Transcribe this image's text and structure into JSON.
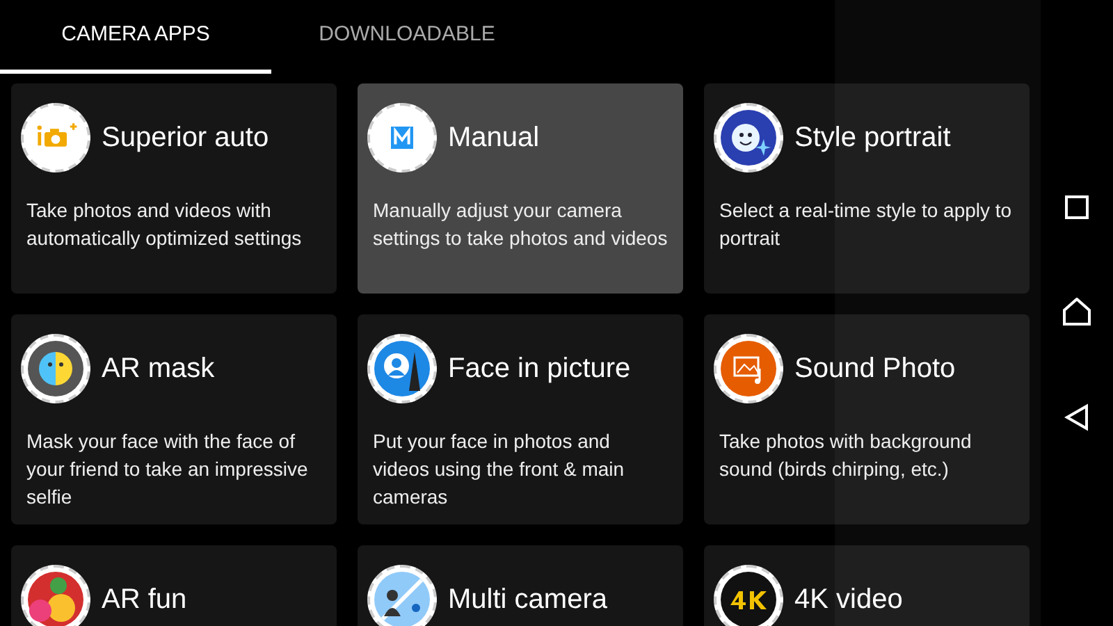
{
  "tabs": [
    {
      "label": "CAMERA APPS",
      "selected": true
    },
    {
      "label": "DOWNLOADABLE",
      "selected": false
    }
  ],
  "apps": [
    {
      "title": "Superior auto",
      "description": "Take photos and videos with automatically optimized settings",
      "selected": false
    },
    {
      "title": "Manual",
      "description": "Manually adjust your camera settings to take photos and videos",
      "selected": true
    },
    {
      "title": "Style portrait",
      "description": "Select a real-time style to apply to portrait",
      "selected": false
    },
    {
      "title": "AR mask",
      "description": "Mask your face with the face of your friend to take an impressive selfie",
      "selected": false
    },
    {
      "title": "Face in picture",
      "description": "Put your face in photos and videos using the front & main cameras",
      "selected": false
    },
    {
      "title": "Sound Photo",
      "description": "Take photos with background sound (birds chirping, etc.)",
      "selected": false
    },
    {
      "title": "AR fun",
      "selected": false
    },
    {
      "title": "Multi camera",
      "selected": false
    },
    {
      "title": "4K video",
      "selected": false
    }
  ]
}
